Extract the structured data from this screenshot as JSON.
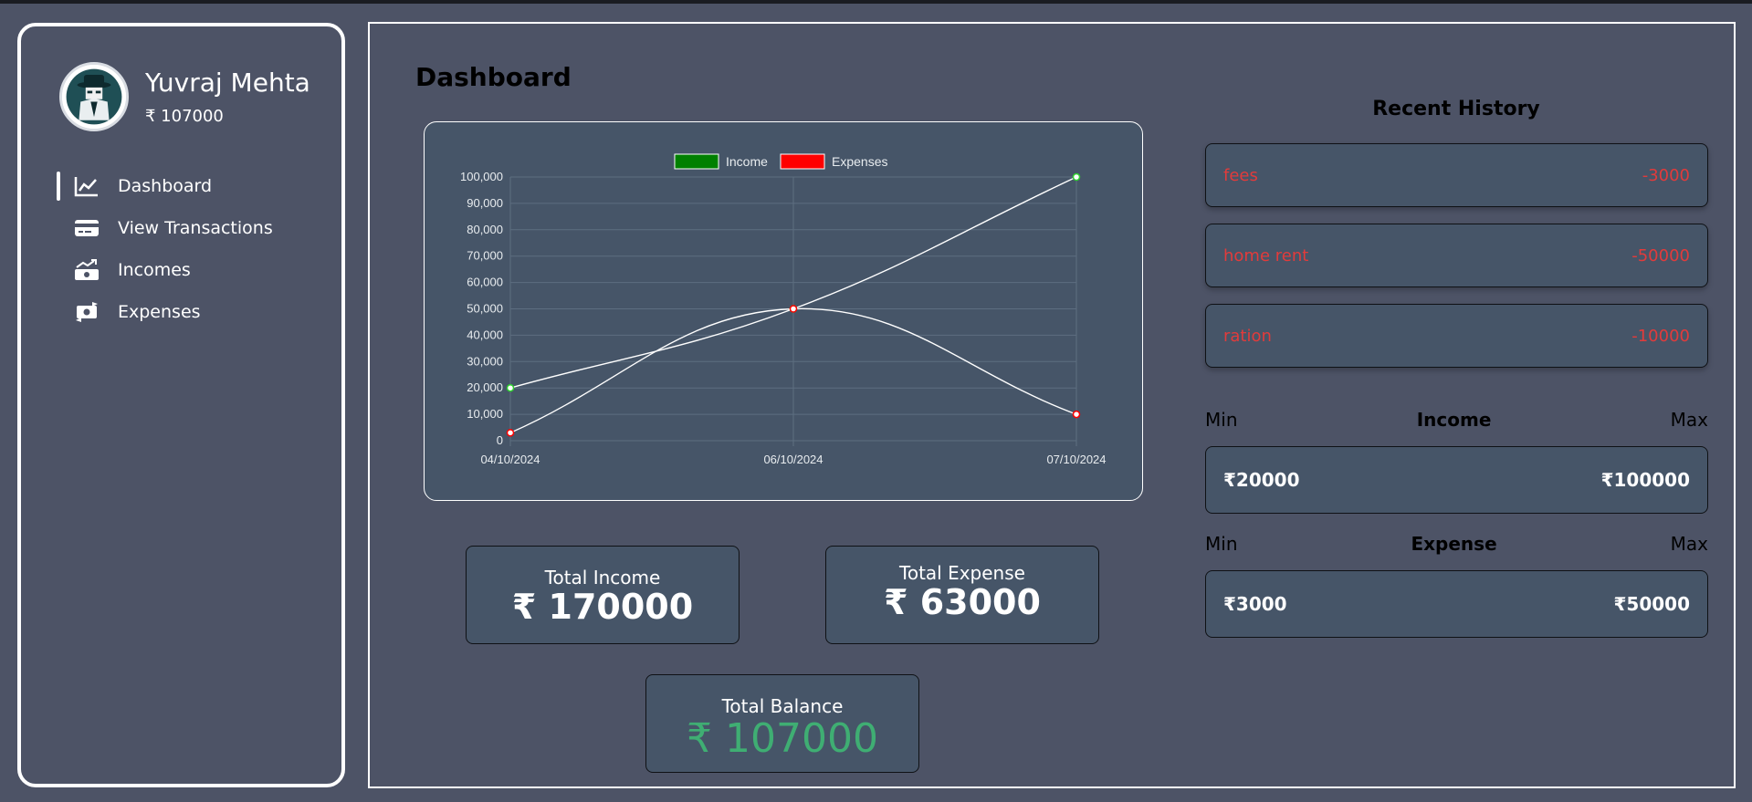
{
  "user": {
    "name": "Yuvraj Mehta",
    "balance": "₹ 107000"
  },
  "sidebar": {
    "items": [
      {
        "label": "Dashboard",
        "icon": "chart-line-icon",
        "active": true
      },
      {
        "label": "View Transactions",
        "icon": "credit-card-icon",
        "active": false
      },
      {
        "label": "Incomes",
        "icon": "money-bill-trend-up-icon",
        "active": false
      },
      {
        "label": "Expenses",
        "icon": "money-bill-transfer-icon",
        "active": false
      }
    ]
  },
  "main": {
    "title": "Dashboard"
  },
  "chart_data": {
    "type": "line",
    "x": [
      "04/10/2024",
      "06/10/2024",
      "07/10/2024"
    ],
    "series": [
      {
        "name": "Income",
        "values": [
          20000,
          50000,
          100000
        ],
        "color": "#008000"
      },
      {
        "name": "Expenses",
        "values": [
          3000,
          50000,
          10000
        ],
        "color": "#ff0000"
      }
    ],
    "yticks": [
      "0",
      "10,000",
      "20,000",
      "30,000",
      "40,000",
      "50,000",
      "60,000",
      "70,000",
      "80,000",
      "90,000",
      "100,000"
    ],
    "ylim": [
      0,
      100000
    ],
    "grid": true,
    "legend": "top-center"
  },
  "stats": {
    "total_income": {
      "label": "Total Income",
      "value": "₹ 170000"
    },
    "total_expense": {
      "label": "Total Expense",
      "value": "₹ 63000"
    },
    "total_balance": {
      "label": "Total Balance",
      "value": "₹ 107000",
      "color": "#3fae73"
    }
  },
  "recent_history": {
    "title": "Recent History",
    "items": [
      {
        "name": "fees",
        "amount": "-3000"
      },
      {
        "name": "home rent",
        "amount": "-50000"
      },
      {
        "name": "ration",
        "amount": "-10000"
      }
    ]
  },
  "income_range": {
    "min_label": "Min",
    "title": "Income",
    "max_label": "Max",
    "min": "₹20000",
    "max": "₹100000"
  },
  "expense_range": {
    "min_label": "Min",
    "title": "Expense",
    "max_label": "Max",
    "min": "₹3000",
    "max": "₹50000"
  },
  "colors": {
    "background": "#4d5366",
    "card": "#465568",
    "negative": "#e23b3b",
    "positive": "#3fae73"
  }
}
